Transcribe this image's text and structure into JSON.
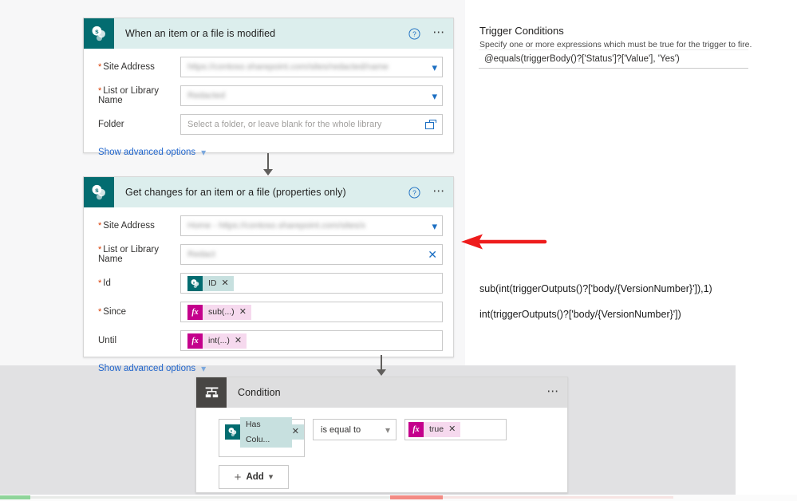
{
  "colors": {
    "sharepoint_teal": "#036C70",
    "header_teal": "#DCEEED",
    "condition_gray": "#484644",
    "token_sp_fill": "#C7E0DF",
    "token_fx_fill": "#F6D9EE",
    "token_fx_icon": "#C4008C",
    "annotation_red": "#EE1C1C",
    "branch_yes_green": "#8FD49A",
    "branch_no_red": "#F38B84",
    "link_blue": "#2266CC"
  },
  "cards": {
    "trigger": {
      "title": "When an item or a file is modified",
      "icon": "sharepoint-icon",
      "help_icon": "help-icon",
      "more_icon": "more-options-icon",
      "fields": [
        {
          "label": "Site Address",
          "required": true,
          "value": "",
          "redacted": true,
          "placeholder": "",
          "control": "dropdown"
        },
        {
          "label": "List or Library Name",
          "required": true,
          "value": "",
          "redacted": true,
          "placeholder": "",
          "control": "dropdown"
        },
        {
          "label": "Folder",
          "required": false,
          "value": "",
          "redacted": false,
          "placeholder": "Select a folder, or leave blank for the whole library",
          "control": "folder-picker"
        }
      ],
      "advanced_label": "Show advanced options"
    },
    "get_changes": {
      "title": "Get changes for an item or a file (properties only)",
      "icon": "sharepoint-icon",
      "help_icon": "help-icon",
      "more_icon": "more-options-icon",
      "fields": [
        {
          "label": "Site Address",
          "required": true,
          "value": "",
          "redacted": true,
          "placeholder": "",
          "control": "dropdown"
        },
        {
          "label": "List or Library Name",
          "required": true,
          "value": "",
          "redacted": true,
          "placeholder": "",
          "control": "clear"
        },
        {
          "label": "Id",
          "required": true,
          "control": "token",
          "token": {
            "kind": "sharepoint",
            "label": "ID"
          }
        },
        {
          "label": "Since",
          "required": true,
          "control": "token",
          "token": {
            "kind": "expression",
            "label": "sub(...)"
          }
        },
        {
          "label": "Until",
          "required": false,
          "control": "token",
          "token": {
            "kind": "expression",
            "label": "int(...)"
          }
        }
      ],
      "advanced_label": "Show advanced options"
    },
    "condition": {
      "title": "Condition",
      "icon": "condition-icon",
      "more_icon": "more-options-icon",
      "operand_token": {
        "kind": "sharepoint",
        "label": "Has Colu..."
      },
      "operator": "is equal to",
      "value_token": {
        "kind": "expression",
        "label": "true"
      },
      "add_label": "Add"
    }
  },
  "trigger_conditions": {
    "title": "Trigger Conditions",
    "subtitle": "Specify one or more expressions which must be true for the trigger to fire.",
    "expression": "@equals(triggerBody()?['Status']?['Value'], 'Yes')"
  },
  "annotations": {
    "expression_1": "sub(int(triggerOutputs()?['body/{VersionNumber}']),1)",
    "expression_2": "int(triggerOutputs()?['body/{VersionNumber}'])",
    "arrow": "red-left-arrow"
  }
}
